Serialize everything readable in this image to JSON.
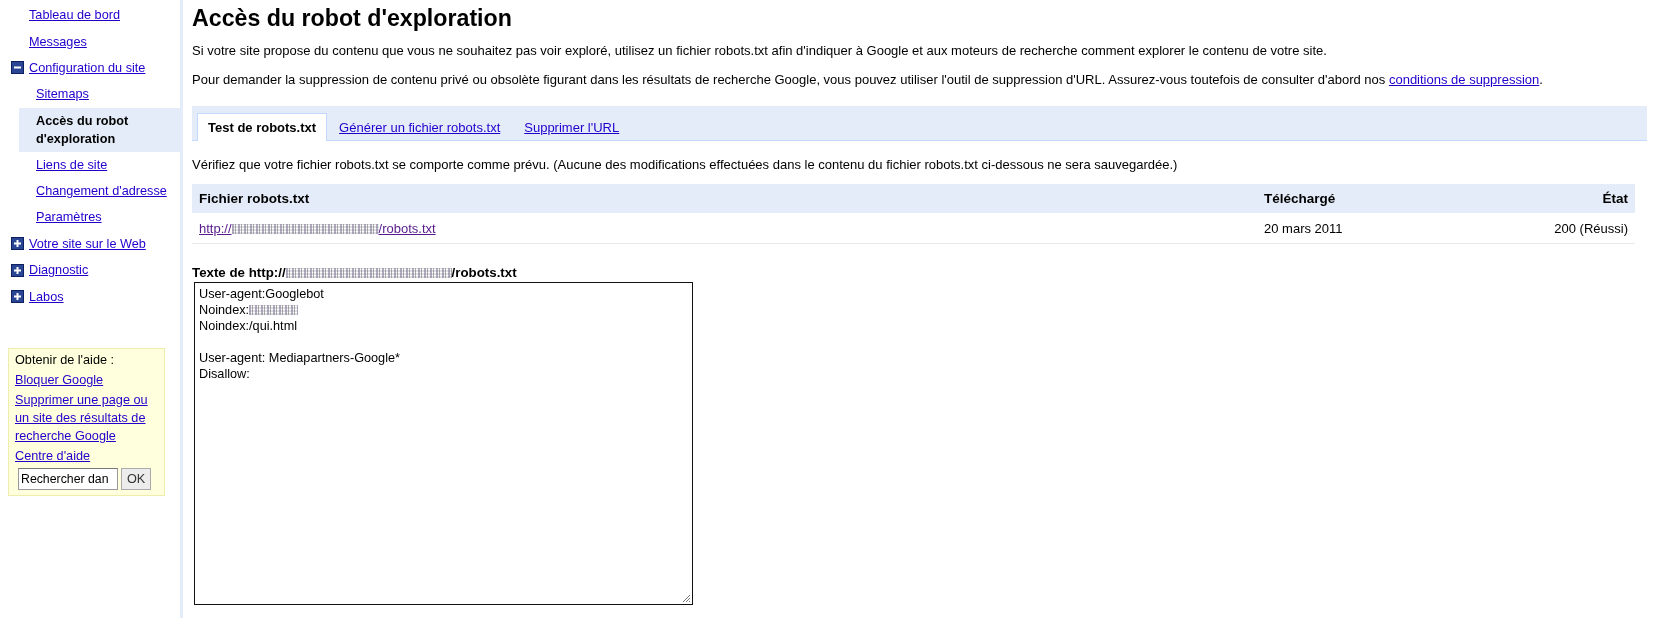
{
  "sidebar": {
    "items": [
      {
        "kind": "link",
        "label": "Tableau de bord",
        "selected": false
      },
      {
        "kind": "link",
        "label": "Messages",
        "selected": false
      },
      {
        "kind": "group",
        "label": "Configuration du site",
        "selected": false,
        "expanded": true,
        "children": [
          {
            "label": "Sitemaps",
            "selected": false
          },
          {
            "label": "Accès du robot d'exploration",
            "selected": true
          },
          {
            "label": "Liens de site",
            "selected": false
          },
          {
            "label": "Changement d'adresse",
            "selected": false
          },
          {
            "label": "Paramètres",
            "selected": false
          }
        ]
      },
      {
        "kind": "group",
        "label": "Votre site sur le Web",
        "selected": false,
        "expanded": false
      },
      {
        "kind": "group",
        "label": "Diagnostic",
        "selected": false,
        "expanded": false
      },
      {
        "kind": "group",
        "label": "Labos",
        "selected": false,
        "expanded": false
      }
    ],
    "help": {
      "title": "Obtenir de l'aide :",
      "links": [
        "Bloquer Google",
        "Supprimer une page ou un site des résultats de recherche Google",
        "Centre d'aide"
      ],
      "search": {
        "value": "Rechercher dan"
      },
      "button": "OK"
    }
  },
  "page": {
    "title": "Accès du robot d'exploration",
    "paragraphs": [
      {
        "text": "Si votre site propose du contenu que vous ne souhaitez pas voir exploré, utilisez un fichier robots.txt afin d'indiquer à Google et aux moteurs de recherche comment explorer le contenu de votre site."
      },
      {
        "text": "Pour demander la suppression de contenu privé ou obsolète figurant dans les résultats de recherche Google, vous pouvez utiliser l'outil de suppression d'URL. Assurez-vous toutefois de consulter d'abord nos ",
        "link": "conditions de suppression",
        "after": "."
      }
    ]
  },
  "tabs": [
    {
      "label": "Test de robots.txt",
      "selected": true
    },
    {
      "label": "Générer un fichier robots.txt",
      "selected": false
    },
    {
      "label": "Supprimer l'URL",
      "selected": false
    }
  ],
  "tab_panel": {
    "description": "Vérifiez que votre fichier robots.txt se comporte comme prévu. (Aucune des modifications effectuées dans le contenu du fichier robots.txt ci-dessous ne sera sauvegardée.)",
    "table": {
      "columns": [
        "Fichier robots.txt",
        "Téléchargé",
        "État"
      ],
      "rows": [
        {
          "url_prefix": "http://",
          "redacted": true,
          "url_suffix": "/robots.txt",
          "downloaded": "20 mars 2011",
          "status": "200 (Réussi)"
        }
      ]
    },
    "file_text": {
      "label_prefix": "Texte de http://",
      "redacted": true,
      "label_suffix": "/robots.txt",
      "blocks": [
        [
          {
            "text": "User-agent:Googlebot",
            "redacted": false
          },
          {
            "text": "Noindex:",
            "redacted": true
          },
          {
            "text": "Noindex:/qui.html",
            "redacted": false
          }
        ],
        [
          {
            "text": "User-agent: Mediapartners-Google*",
            "redacted": false
          },
          {
            "text": "Disallow:",
            "redacted": false
          }
        ]
      ]
    }
  }
}
